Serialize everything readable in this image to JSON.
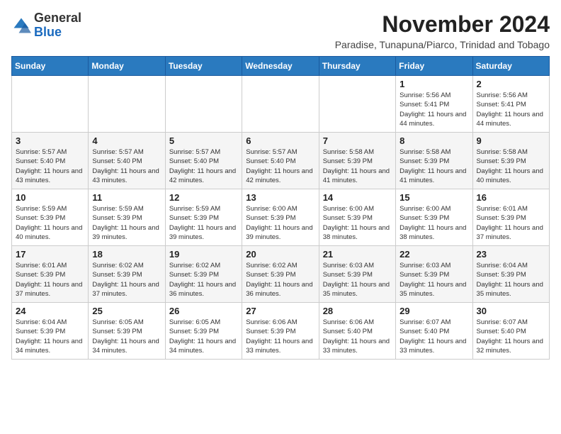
{
  "header": {
    "logo_general": "General",
    "logo_blue": "Blue",
    "month_year": "November 2024",
    "location": "Paradise, Tunapuna/Piarco, Trinidad and Tobago"
  },
  "weekdays": [
    "Sunday",
    "Monday",
    "Tuesday",
    "Wednesday",
    "Thursday",
    "Friday",
    "Saturday"
  ],
  "weeks": [
    [
      {
        "day": null,
        "info": null
      },
      {
        "day": null,
        "info": null
      },
      {
        "day": null,
        "info": null
      },
      {
        "day": null,
        "info": null
      },
      {
        "day": null,
        "info": null
      },
      {
        "day": "1",
        "info": "Sunrise: 5:56 AM\nSunset: 5:41 PM\nDaylight: 11 hours and 44 minutes."
      },
      {
        "day": "2",
        "info": "Sunrise: 5:56 AM\nSunset: 5:41 PM\nDaylight: 11 hours and 44 minutes."
      }
    ],
    [
      {
        "day": "3",
        "info": "Sunrise: 5:57 AM\nSunset: 5:40 PM\nDaylight: 11 hours and 43 minutes."
      },
      {
        "day": "4",
        "info": "Sunrise: 5:57 AM\nSunset: 5:40 PM\nDaylight: 11 hours and 43 minutes."
      },
      {
        "day": "5",
        "info": "Sunrise: 5:57 AM\nSunset: 5:40 PM\nDaylight: 11 hours and 42 minutes."
      },
      {
        "day": "6",
        "info": "Sunrise: 5:57 AM\nSunset: 5:40 PM\nDaylight: 11 hours and 42 minutes."
      },
      {
        "day": "7",
        "info": "Sunrise: 5:58 AM\nSunset: 5:39 PM\nDaylight: 11 hours and 41 minutes."
      },
      {
        "day": "8",
        "info": "Sunrise: 5:58 AM\nSunset: 5:39 PM\nDaylight: 11 hours and 41 minutes."
      },
      {
        "day": "9",
        "info": "Sunrise: 5:58 AM\nSunset: 5:39 PM\nDaylight: 11 hours and 40 minutes."
      }
    ],
    [
      {
        "day": "10",
        "info": "Sunrise: 5:59 AM\nSunset: 5:39 PM\nDaylight: 11 hours and 40 minutes."
      },
      {
        "day": "11",
        "info": "Sunrise: 5:59 AM\nSunset: 5:39 PM\nDaylight: 11 hours and 39 minutes."
      },
      {
        "day": "12",
        "info": "Sunrise: 5:59 AM\nSunset: 5:39 PM\nDaylight: 11 hours and 39 minutes."
      },
      {
        "day": "13",
        "info": "Sunrise: 6:00 AM\nSunset: 5:39 PM\nDaylight: 11 hours and 39 minutes."
      },
      {
        "day": "14",
        "info": "Sunrise: 6:00 AM\nSunset: 5:39 PM\nDaylight: 11 hours and 38 minutes."
      },
      {
        "day": "15",
        "info": "Sunrise: 6:00 AM\nSunset: 5:39 PM\nDaylight: 11 hours and 38 minutes."
      },
      {
        "day": "16",
        "info": "Sunrise: 6:01 AM\nSunset: 5:39 PM\nDaylight: 11 hours and 37 minutes."
      }
    ],
    [
      {
        "day": "17",
        "info": "Sunrise: 6:01 AM\nSunset: 5:39 PM\nDaylight: 11 hours and 37 minutes."
      },
      {
        "day": "18",
        "info": "Sunrise: 6:02 AM\nSunset: 5:39 PM\nDaylight: 11 hours and 37 minutes."
      },
      {
        "day": "19",
        "info": "Sunrise: 6:02 AM\nSunset: 5:39 PM\nDaylight: 11 hours and 36 minutes."
      },
      {
        "day": "20",
        "info": "Sunrise: 6:02 AM\nSunset: 5:39 PM\nDaylight: 11 hours and 36 minutes."
      },
      {
        "day": "21",
        "info": "Sunrise: 6:03 AM\nSunset: 5:39 PM\nDaylight: 11 hours and 35 minutes."
      },
      {
        "day": "22",
        "info": "Sunrise: 6:03 AM\nSunset: 5:39 PM\nDaylight: 11 hours and 35 minutes."
      },
      {
        "day": "23",
        "info": "Sunrise: 6:04 AM\nSunset: 5:39 PM\nDaylight: 11 hours and 35 minutes."
      }
    ],
    [
      {
        "day": "24",
        "info": "Sunrise: 6:04 AM\nSunset: 5:39 PM\nDaylight: 11 hours and 34 minutes."
      },
      {
        "day": "25",
        "info": "Sunrise: 6:05 AM\nSunset: 5:39 PM\nDaylight: 11 hours and 34 minutes."
      },
      {
        "day": "26",
        "info": "Sunrise: 6:05 AM\nSunset: 5:39 PM\nDaylight: 11 hours and 34 minutes."
      },
      {
        "day": "27",
        "info": "Sunrise: 6:06 AM\nSunset: 5:39 PM\nDaylight: 11 hours and 33 minutes."
      },
      {
        "day": "28",
        "info": "Sunrise: 6:06 AM\nSunset: 5:40 PM\nDaylight: 11 hours and 33 minutes."
      },
      {
        "day": "29",
        "info": "Sunrise: 6:07 AM\nSunset: 5:40 PM\nDaylight: 11 hours and 33 minutes."
      },
      {
        "day": "30",
        "info": "Sunrise: 6:07 AM\nSunset: 5:40 PM\nDaylight: 11 hours and 32 minutes."
      }
    ]
  ]
}
